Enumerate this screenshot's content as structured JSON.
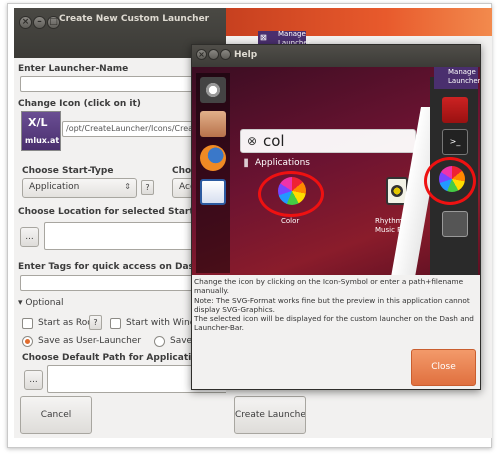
{
  "main_window": {
    "title": "Create New Custom Launcher",
    "launcher_name_label": "Enter Launcher-Name",
    "change_icon_label": "Change Icon (click on it)",
    "icon_path": "/opt/CreateLauncher/Icons/CreateLaun",
    "logo_text_top": "X/L",
    "logo_text_bottom": "mlux.at",
    "start_type_label": "Choose Start-Type",
    "start_type_value": "Application",
    "help_button": "?",
    "cat_label_partial": "Choo",
    "cat_value_partial": "Acc",
    "location_label": "Choose Location for selected Start-Type",
    "browse_button": "...",
    "tags_label": "Enter Tags for quick access on Dash",
    "optional_label": "Optional",
    "start_as_root": "Start as Root",
    "start_with_wine": "Start with Wine",
    "save_user": "Save as User-Launcher",
    "save_system": "Save as Sy",
    "default_path_label": "Choose Default Path for Application",
    "cancel_button": "Cancel",
    "create_button": "Create Launcher"
  },
  "help_window": {
    "title": "Help",
    "manage_text_1": "Manage",
    "manage_text_2": "Launcher",
    "search_text": "col",
    "applications_label": "Applications",
    "color_label": "Color",
    "rhythmbox_label_1": "Rhythm",
    "rhythmbox_label_2": "Music P",
    "description": "Change the icon by clicking on the Icon-Symbol or enter a path+filename manually.\nNote: The SVG-Format works fine but the preview in this application cannot display SVG-Graphics.\nThe selected icon will be displayed for the custom launcher on the Dash and Launcher-Bar.",
    "close_button": "Close"
  },
  "top_banner": {
    "manage_text_1": "Manage",
    "manage_text_2": "Launcher"
  },
  "colors": {
    "title_bar": "#3c3b37",
    "ubuntu_orange": "#e0703f",
    "highlight_ring": "#ee1111"
  }
}
